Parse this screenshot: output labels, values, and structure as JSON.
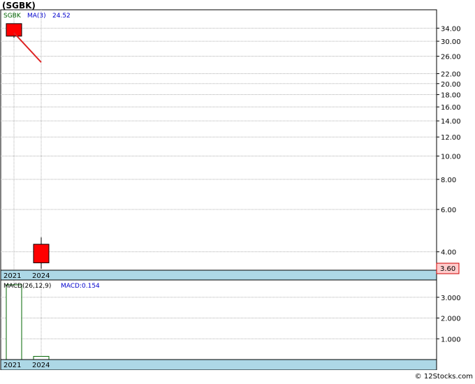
{
  "header": {
    "title": "(SGBK)"
  },
  "price_panel": {
    "ticker_label": "SGBK",
    "ma_label": "MA(3)",
    "ma_value": "24.52",
    "last_price_badge": "3.60",
    "x_labels": [
      "2021",
      "2024"
    ]
  },
  "macd_panel": {
    "label": "MACD(26,12,9)",
    "value_label": "MACD:0.154",
    "x_labels": [
      "2021",
      "2024"
    ]
  },
  "footer": {
    "copyright": "© 12Stocks.com"
  },
  "colors": {
    "candle_down": "#ff0000",
    "ma_line": "#dd2222",
    "axis_strip": "#add8e6",
    "ticker_text": "#006400",
    "ma_text": "#0000cc",
    "macd_bar_stroke": "#006400"
  },
  "chart_data": [
    {
      "type": "candlestick",
      "scale": "log",
      "x": [
        "2021",
        "2024"
      ],
      "ylim": [
        3.4,
        40
      ],
      "y_ticks": [
        34.0,
        30.0,
        26.0,
        22.0,
        20.0,
        18.0,
        16.0,
        14.0,
        12.0,
        10.0,
        8.0,
        6.0,
        4.0
      ],
      "y_tick_labels": [
        "34.00",
        "30.00",
        "26.00",
        "22.00",
        "20.00",
        "18.00",
        "16.00",
        "14.00",
        "12.00",
        "10.00",
        "8.00",
        "6.00",
        "4.00"
      ],
      "candles": [
        {
          "x": "2021",
          "open": 35.5,
          "close": 31.5,
          "high": 35.5,
          "low": 31.0
        },
        {
          "x": "2024",
          "open": 4.3,
          "close": 3.6,
          "high": 4.6,
          "low": 3.4
        }
      ],
      "ma_series": {
        "x": [
          "2021",
          "2024"
        ],
        "values": [
          32.5,
          24.52
        ]
      },
      "grid": true
    },
    {
      "type": "bar",
      "x": [
        "2021",
        "2024"
      ],
      "values": [
        3.6,
        0.154
      ],
      "ylim": [
        0,
        3.8
      ],
      "y_ticks": [
        3.0,
        2.0,
        1.0
      ],
      "y_tick_labels": [
        "3.000",
        "2.000",
        "1.000"
      ],
      "grid": true
    }
  ]
}
